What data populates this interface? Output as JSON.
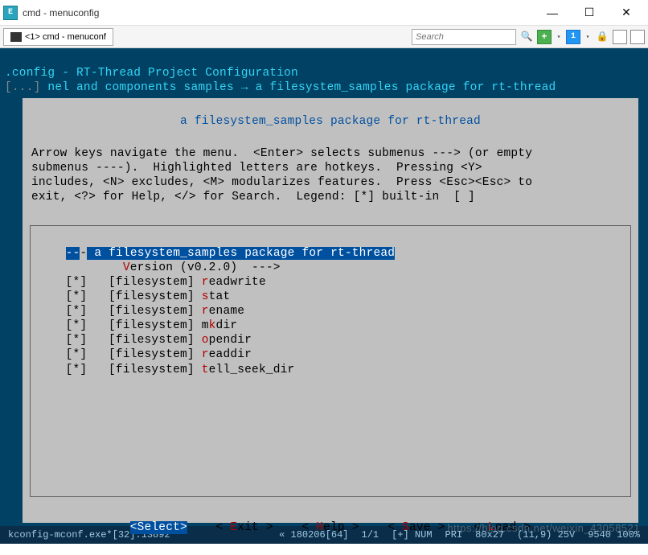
{
  "window": {
    "title": "cmd - menuconfig",
    "minimize": "—",
    "maximize": "☐",
    "close": "✕"
  },
  "tab": {
    "label": "<1> cmd - menuconf"
  },
  "search": {
    "placeholder": "Search"
  },
  "toolbar": {
    "plus": "+",
    "num": "1",
    "drop": "▾"
  },
  "config": {
    "line1": ".config - RT-Thread Project Configuration",
    "line2_prefix": "[...] ",
    "line2_text": "nel and components samples → a filesystem_samples package for rt-thread"
  },
  "box": {
    "title": " a filesystem_samples package for rt-thread ",
    "help": "Arrow keys navigate the menu.  <Enter> selects submenus ---> (or empty\nsubmenus ----).  Highlighted letters are hotkeys.  Pressing <Y>\nincludes, <N> excludes, <M> modularizes features.  Press <Esc><Esc> to\nexit, <?> for Help, </> for Search.  Legend: [*] built-in  [ ]"
  },
  "menu": {
    "items": [
      {
        "state": "---",
        "prefix": "",
        "hotkey": "",
        "label": " a filesystem_samples package for rt-thread",
        "selected": true
      },
      {
        "state": "   ",
        "prefix": "    ",
        "hotkey": "V",
        "label": "ersion (v0.2.0)  --->",
        "selected": false
      },
      {
        "state": "[*]",
        "prefix": "  [filesystem] ",
        "hotkey": "r",
        "label": "eadwrite",
        "selected": false
      },
      {
        "state": "[*]",
        "prefix": "  [filesystem] ",
        "hotkey": "s",
        "label": "tat",
        "selected": false
      },
      {
        "state": "[*]",
        "prefix": "  [filesystem] ",
        "hotkey": "r",
        "label": "ename",
        "selected": false
      },
      {
        "state": "[*]",
        "prefix": "  [filesystem] m",
        "hotkey": "k",
        "label": "dir",
        "selected": false
      },
      {
        "state": "[*]",
        "prefix": "  [filesystem] ",
        "hotkey": "o",
        "label": "pendir",
        "selected": false
      },
      {
        "state": "[*]",
        "prefix": "  [filesystem] ",
        "hotkey": "r",
        "label": "eaddir",
        "selected": false
      },
      {
        "state": "[*]",
        "prefix": "  [filesystem] ",
        "hotkey": "t",
        "label": "ell_seek_dir",
        "selected": false
      }
    ]
  },
  "buttons": {
    "select": "<Select>",
    "exit_pre": "< ",
    "exit_hk": "E",
    "exit_post": "xit >",
    "help_pre": "< ",
    "help_hk": "H",
    "help_post": "elp >",
    "save_pre": "< ",
    "save_hk": "S",
    "save_post": "ave >",
    "load_pre": "< ",
    "load_hk": "L",
    "load_post": "oad >"
  },
  "status": {
    "exe": "kconfig-mconf.exe*[32]:13892",
    "encoding": "« 180206[64]",
    "pos": "1/1",
    "numlock": "[+] NUM",
    "pri": "PRI",
    "dims1": "80x27",
    "dims2": "(11,9) 25V",
    "dims3": "9540 100%"
  },
  "watermark": "https://blog.csdn.net/weixin_43058521"
}
